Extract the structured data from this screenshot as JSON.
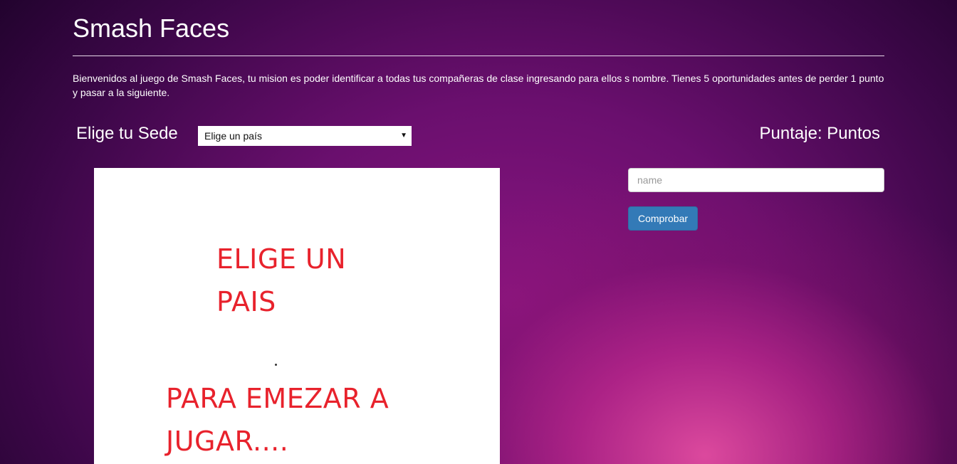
{
  "header": {
    "title": "Smash Faces"
  },
  "intro": {
    "text": "Bienvenidos al juego de Smash Faces, tu mision es poder identificar a todas tus compañeras de clase ingresando para ellos s nombre. Tienes 5 oportunidades antes de perder 1 punto y pasar a la siguiente."
  },
  "controls": {
    "sede_label": "Elige tu Sede",
    "country_select": {
      "selected": "Elige un país",
      "arrow": "▼"
    },
    "score_label": "Puntaje: Puntos"
  },
  "image": {
    "lines": [
      "ELIGE UN",
      "PAIS",
      "PARA EMEZAR A",
      "JUGAR...."
    ],
    "text_color": "#e8222c"
  },
  "form": {
    "name_placeholder": "name",
    "name_value": "",
    "submit_label": "Comprobar"
  },
  "colors": {
    "button_primary": "#337ab7",
    "background_accent": "#e24ca0"
  }
}
